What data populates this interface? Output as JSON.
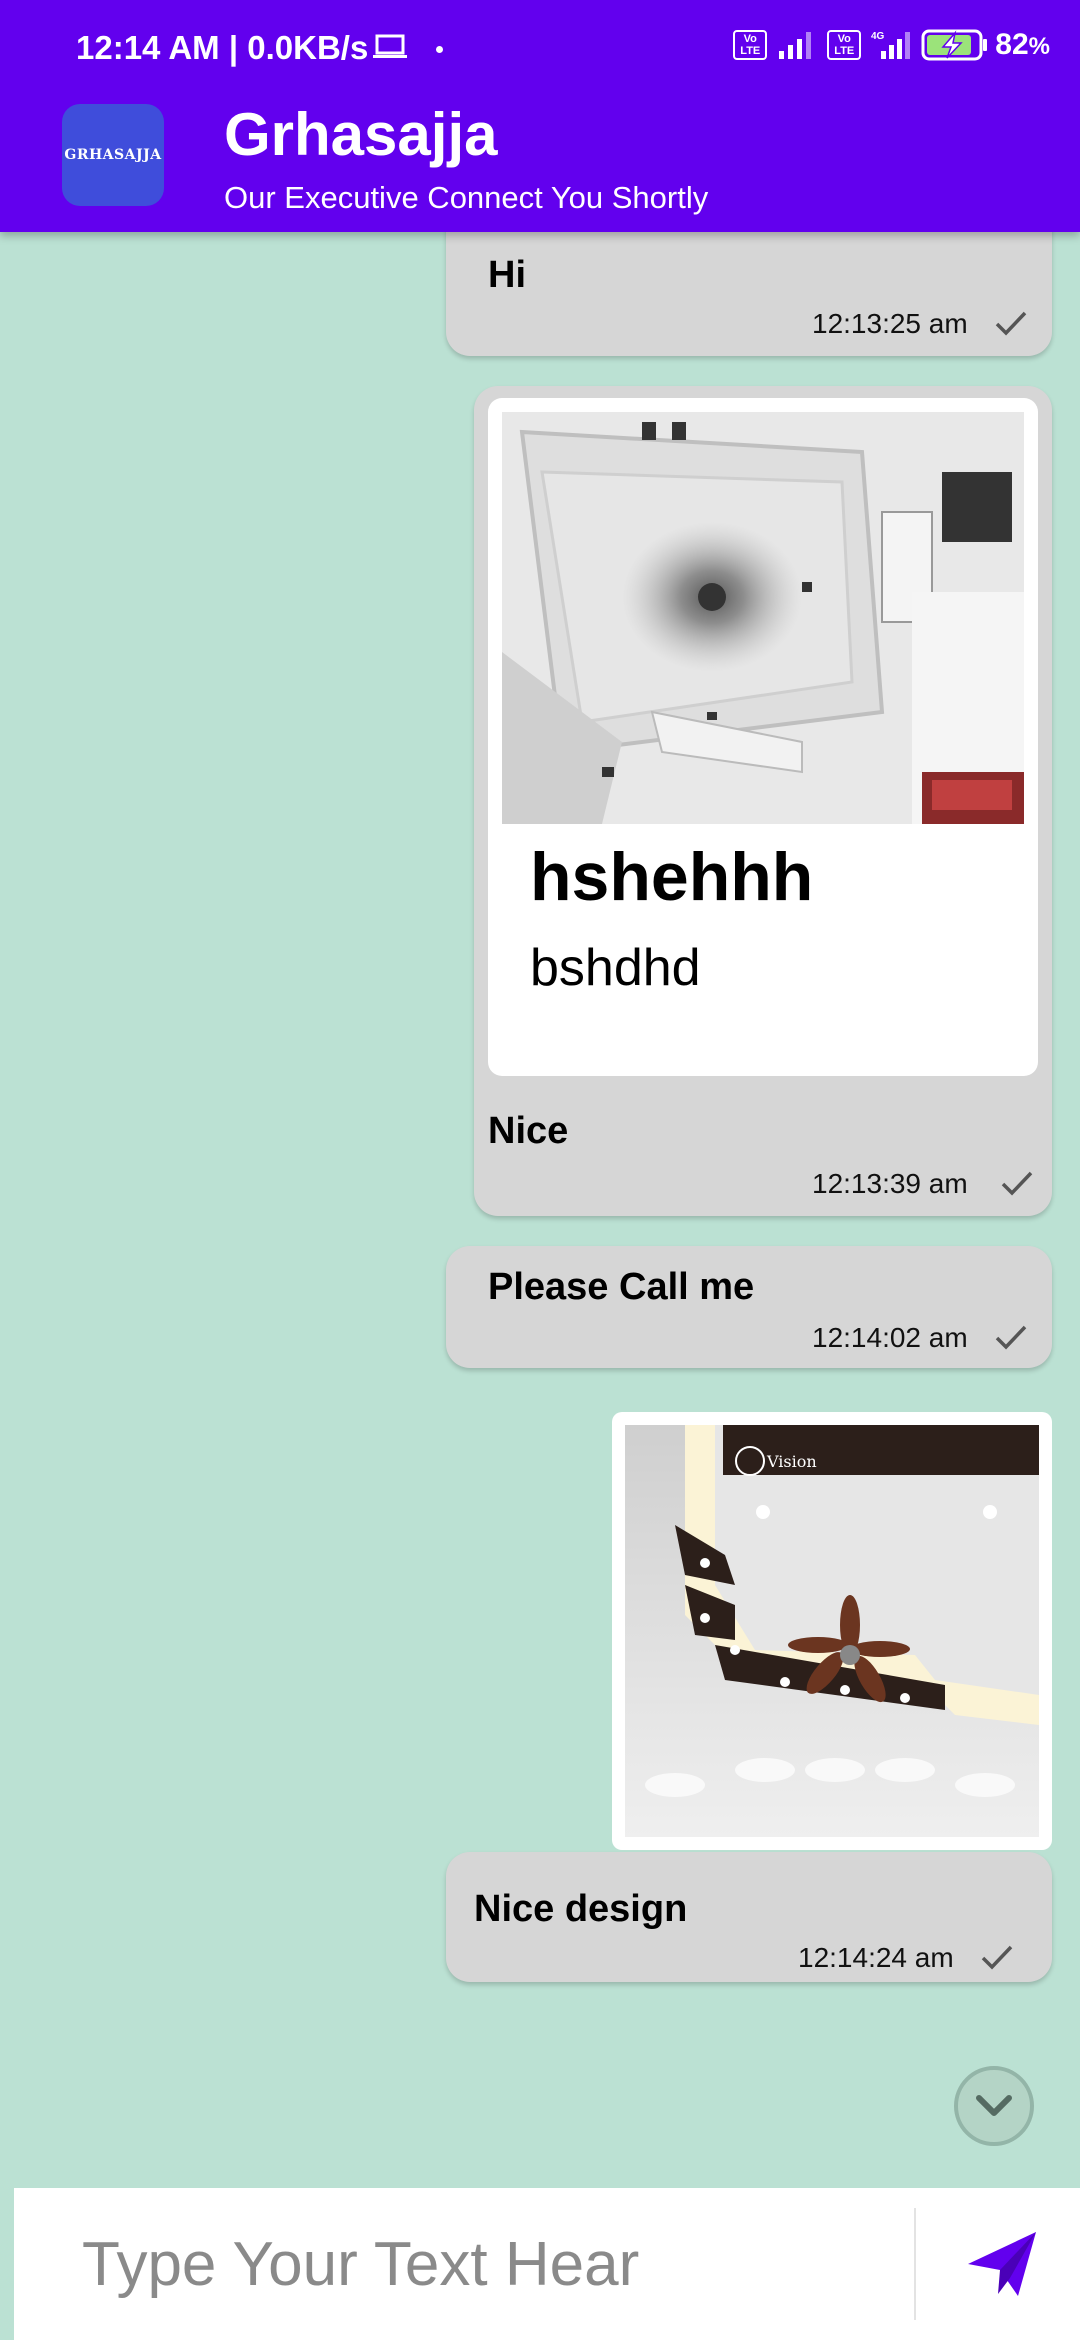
{
  "status_bar": {
    "time_speed": "12:14 AM | 0.0KB/s",
    "volte_label": "Vo\nLTE",
    "network_label": "4G",
    "battery_percent": "82",
    "battery_unit": "%"
  },
  "header": {
    "logo_text": "GRHASAJJA",
    "title": "Grhasajja",
    "subtitle": "Our Executive Connect You Shortly"
  },
  "messages": [
    {
      "type": "text",
      "text": "Hi",
      "time": "12:13:25 am",
      "status_icon": "check-icon"
    },
    {
      "type": "card",
      "card_title": "hshehhh",
      "card_description": "bshdhd",
      "text": "Nice",
      "time": "12:13:39 am",
      "status_icon": "check-icon"
    },
    {
      "type": "text",
      "text": "Please Call me",
      "time": "12:14:02 am",
      "status_icon": "check-icon"
    },
    {
      "type": "image",
      "image_caption_logo": "Vision"
    },
    {
      "type": "text",
      "text": "Nice design",
      "time": "12:14:24 am",
      "status_icon": "check-icon"
    }
  ],
  "composer": {
    "placeholder": "Type Your Text Hear",
    "send_icon": "send-icon"
  },
  "scroll_button_icon": "chevron-down-icon",
  "colors": {
    "header": "#6200ee",
    "background": "#bbe1d3",
    "bubble": "#d6d6d6",
    "send_icon": "#6200ee"
  }
}
